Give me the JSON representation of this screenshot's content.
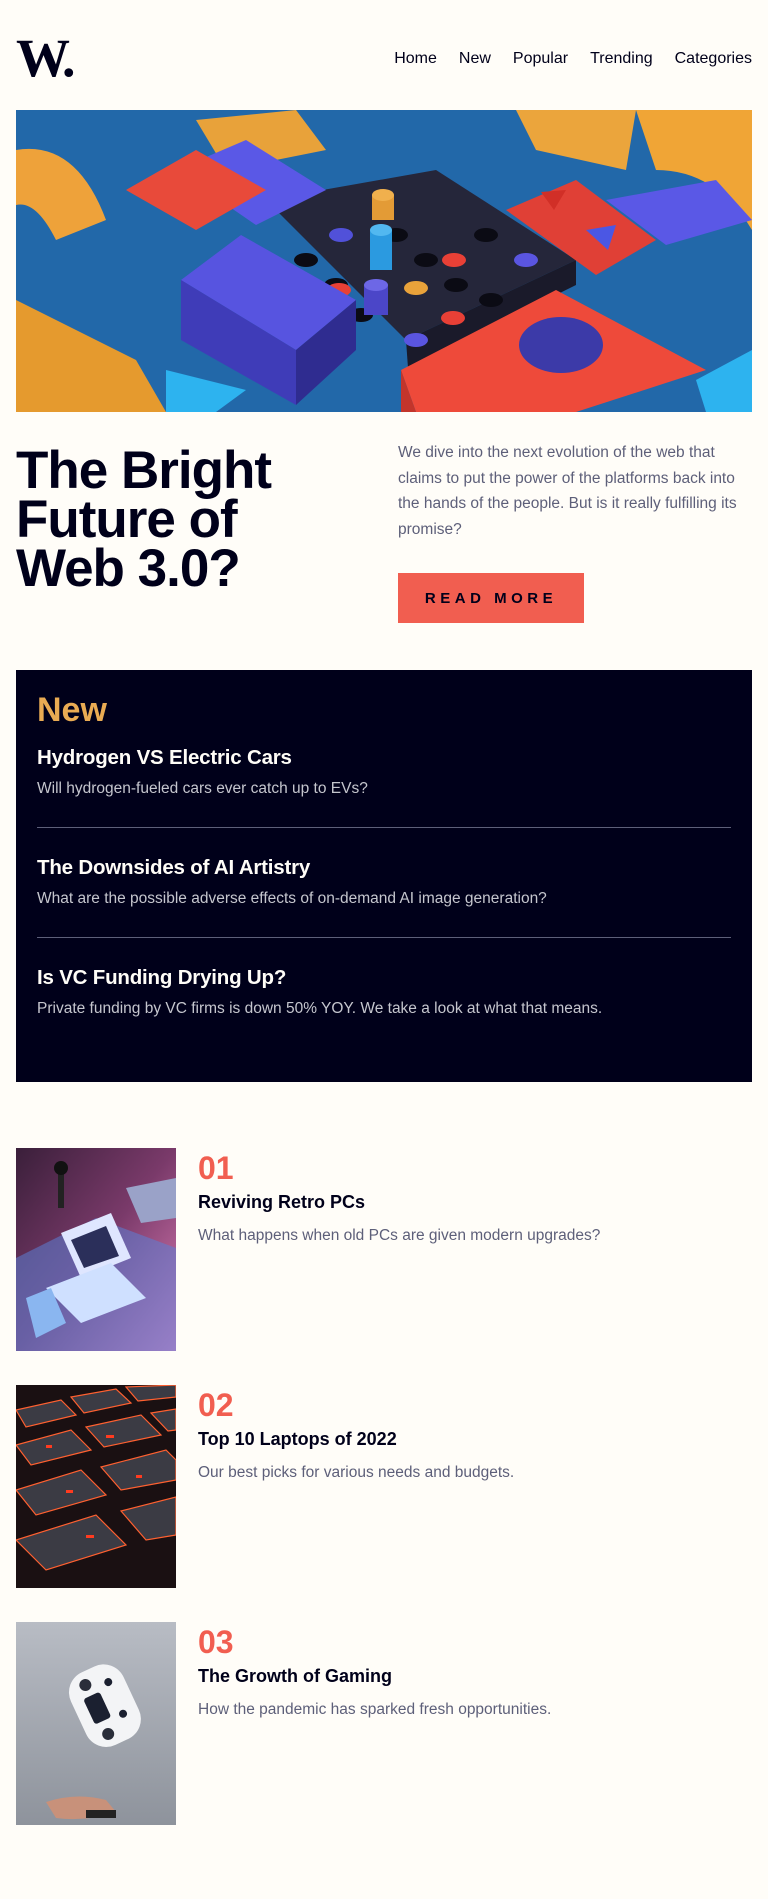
{
  "brand": {
    "logo": "W."
  },
  "nav": {
    "items": [
      "Home",
      "New",
      "Popular",
      "Trending",
      "Categories"
    ]
  },
  "hero": {
    "title": "The Bright Future of Web 3.0?",
    "intro": "We dive into the next evolution of the web that claims to put the power of the platforms back into the hands of the people. But is it really fulfilling its promise?",
    "button": "READ MORE"
  },
  "new_section": {
    "heading": "New",
    "items": [
      {
        "title": "Hydrogen VS Electric Cars",
        "desc": "Will hydrogen-fueled cars ever catch up to EVs?"
      },
      {
        "title": "The Downsides of AI Artistry",
        "desc": "What are the possible adverse effects of on-demand AI image generation?"
      },
      {
        "title": "Is VC Funding Drying Up?",
        "desc": "Private funding by VC firms is down 50% YOY. We take a look at what that means."
      }
    ]
  },
  "articles": [
    {
      "num": "01",
      "title": "Reviving Retro PCs",
      "desc": "What happens when old PCs are given modern upgrades?"
    },
    {
      "num": "02",
      "title": "Top 10 Laptops of 2022",
      "desc": "Our best picks for various needs and budgets."
    },
    {
      "num": "03",
      "title": "The Growth of Gaming",
      "desc": "How the pandemic has sparked fresh opportunities."
    }
  ],
  "colors": {
    "accent": "#f15e50",
    "highlight": "#e9ab53",
    "dark": "#00001a",
    "background": "#fffdf8",
    "muted": "#5d5f79"
  }
}
